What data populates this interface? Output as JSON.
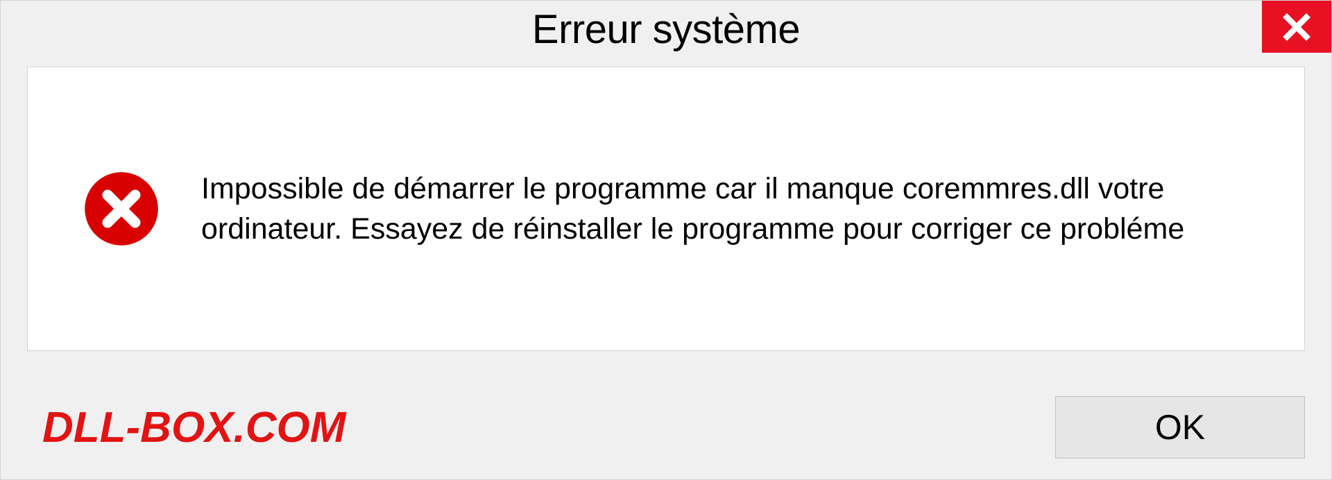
{
  "dialog": {
    "title": "Erreur système",
    "message": "Impossible de démarrer le programme car il manque coremmres.dll votre ordinateur. Essayez de réinstaller le programme pour corriger ce probléme",
    "ok_label": "OK"
  },
  "watermark": "DLL-BOX.COM",
  "colors": {
    "close_bg": "#e81123",
    "error_red": "#d80000",
    "watermark_red": "#e21313",
    "frame_bg": "#ffffff",
    "dialog_bg": "#f0f0f0"
  },
  "icons": {
    "close": "close-icon",
    "error": "error-icon"
  }
}
